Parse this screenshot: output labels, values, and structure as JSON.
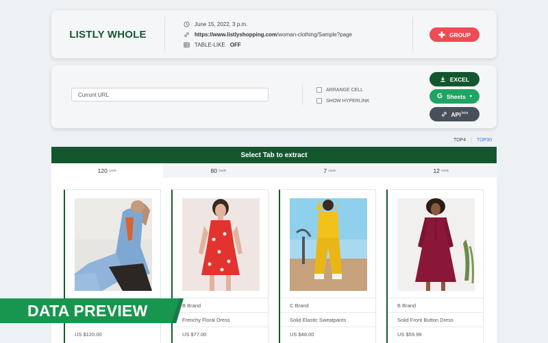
{
  "header": {
    "brand": "LISTLY WHOLE",
    "date": "June 15, 2022, 3 p.m.",
    "url_bold": "https://www.listlyshopping.com",
    "url_rest": "/woman-clothing/Sample?page",
    "table_like_label": "TABLE-LIKE",
    "table_like_value": "OFF",
    "group_label": "GROUP"
  },
  "options": {
    "url_placeholder": "Currunt URL",
    "arrange_cell": "ARRANGE CELL",
    "show_hyperlink": "SHOW HYPERLINK",
    "excel_label": "EXCEL",
    "sheets_label": "Sheets",
    "api_label": "API",
    "api_badge": "beta"
  },
  "toplinks": {
    "top4": "TOP4",
    "sep": "|",
    "top30": "TOP30"
  },
  "panel": {
    "title": "Select Tab to extract",
    "tabs": [
      {
        "count": "120",
        "unit": "cards"
      },
      {
        "count": "80",
        "unit": "cards"
      },
      {
        "count": "7",
        "unit": "cards"
      },
      {
        "count": "12",
        "unit": "cards"
      }
    ]
  },
  "products": [
    {
      "brand": "",
      "name": "",
      "price": "US $120.00"
    },
    {
      "brand": "B Brand",
      "name": "Frenchy Floral Dress",
      "price": "US $77.00"
    },
    {
      "brand": "C Brand",
      "name": "Solid Elastic Sweatpants",
      "price": "US $48.00"
    },
    {
      "brand": "B Brand",
      "name": "Solid Front Button Dress",
      "price": "US $59.99"
    }
  ],
  "ribbon": {
    "label": "DATA PREVIEW"
  },
  "colors": {
    "brand_green": "#14572f",
    "group_red": "#ee4c54",
    "sheets_green": "#1fa463",
    "api_gray": "#48505a",
    "link_blue": "#2a7de1"
  }
}
